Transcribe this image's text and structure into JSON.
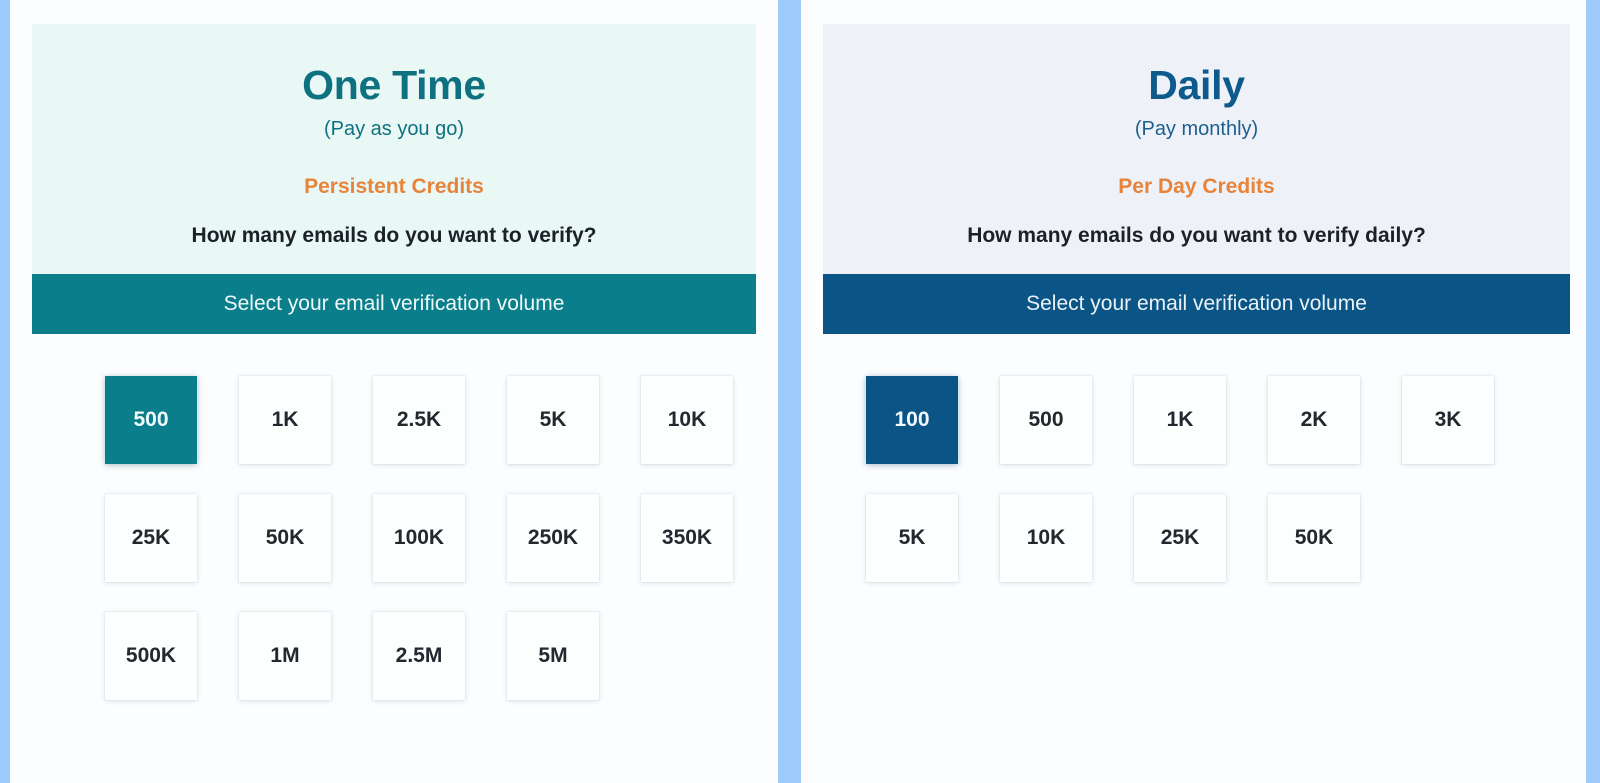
{
  "theme": {
    "page_background": "#9ecbfb",
    "teal_accent": "#0b7e8b",
    "teal_title": "#0d7180",
    "blue_accent": "#0b5586",
    "blue_title": "#0f5a8c",
    "orange_accent": "#e8833a",
    "teal_panel_tint": "#e9f7f5",
    "blue_panel_tint": "#eef2f8",
    "card_background": "#fcfdff"
  },
  "panels": {
    "one_time": {
      "title": "One Time",
      "subtitle": "(Pay as you go)",
      "credit_label": "Persistent Credits",
      "question": "How many emails do you want to verify?",
      "volume_bar_label": "Select your email verification volume",
      "selected_value": "500",
      "tile_rows": [
        [
          "500",
          "1K",
          "2.5K",
          "5K",
          "10K"
        ],
        [
          "25K",
          "50K",
          "100K",
          "250K",
          "350K"
        ],
        [
          "500K",
          "1M",
          "2.5M",
          "5M",
          ""
        ]
      ]
    },
    "daily": {
      "title": "Daily",
      "subtitle": "(Pay monthly)",
      "credit_label": "Per Day Credits",
      "question": "How many emails do you want to verify daily?",
      "volume_bar_label": "Select your email verification volume",
      "selected_value": "100",
      "tile_rows": [
        [
          "100",
          "500",
          "1K",
          "2K",
          "3K"
        ],
        [
          "5K",
          "10K",
          "25K",
          "50K",
          ""
        ]
      ]
    }
  }
}
